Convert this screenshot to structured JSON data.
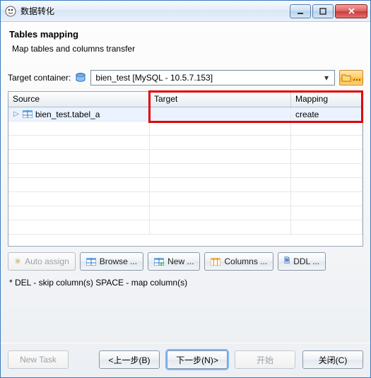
{
  "window": {
    "title": "数据转化"
  },
  "page": {
    "title": "Tables mapping",
    "subtitle": "Map tables and columns transfer"
  },
  "target_container": {
    "label": "Target container:",
    "selected": "bien_test  [MySQL - 10.5.7.153]"
  },
  "grid": {
    "columns": {
      "source": "Source",
      "target": "Target",
      "mapping": "Mapping"
    },
    "rows": [
      {
        "source": "bien_test.tabel_a",
        "target": "",
        "mapping": "create",
        "selected": true
      }
    ]
  },
  "toolbar": {
    "auto_assign": "Auto assign",
    "browse": "Browse ...",
    "new": "New ...",
    "columns": "Columns ...",
    "ddl": "DDL ..."
  },
  "note": "* DEL - skip column(s)  SPACE - map column(s)",
  "footer": {
    "new_task": "New Task",
    "back": "<上一步(B)",
    "next": "下一步(N)>",
    "start": "开始",
    "close": "关闭(C)"
  },
  "colors": {
    "highlight": "#e00000"
  }
}
